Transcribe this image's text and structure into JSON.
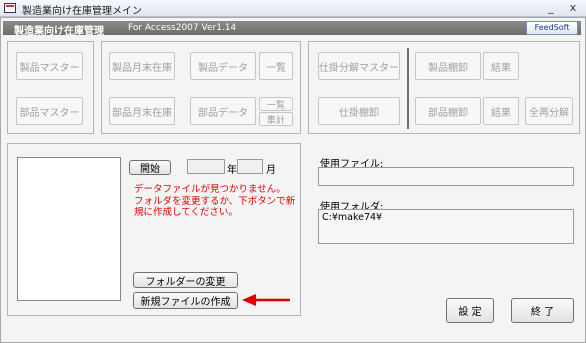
{
  "window": {
    "title": "製造業向け在庫管理メイン",
    "min_glyph": "_",
    "close_glyph": "x"
  },
  "header": {
    "app_title": "製造業向け在庫管理",
    "app_subtitle": "For Access2007   Ver1.14",
    "feedsoft_label": "FeedSoft"
  },
  "master_group": {
    "product_master": "製品マスター",
    "part_master": "部品マスター"
  },
  "month_group": {
    "product_month_stock": "製品月末在庫",
    "product_data": "製品データ",
    "product_list": "一覧",
    "part_month_stock": "部品月末在庫",
    "part_data": "部品データ",
    "part_list": "一覧",
    "part_total": "集計"
  },
  "work_group": {
    "wip_master": "仕掛分解マスター",
    "wip_inventory": "仕掛棚卸",
    "product_inventory": "製品棚卸",
    "product_result": "結果",
    "part_inventory": "部品棚卸",
    "part_result": "結果",
    "full_recalc": "全再分解"
  },
  "start_panel": {
    "start_button": "開始",
    "year_value": "",
    "year_label": "年",
    "month_value": "",
    "month_label": "月",
    "error_line1": "データファイルが見つかりません。",
    "error_line2": "フォルダを変更するか、下ボタンで新",
    "error_line3": "規に作成してください。",
    "change_folder_button": "フォルダーの変更",
    "new_file_button": "新規ファイルの作成"
  },
  "file_panel": {
    "file_label": "使用ファイル:",
    "file_value": "",
    "folder_label": "使用フォルダ:",
    "folder_value": "C:¥make74¥"
  },
  "footer": {
    "settings_button": "設 定",
    "exit_button": "終 了"
  },
  "colors": {
    "error_text": "#e00000",
    "arrow": "#e00000",
    "header_bar": "#7a7a7a"
  }
}
